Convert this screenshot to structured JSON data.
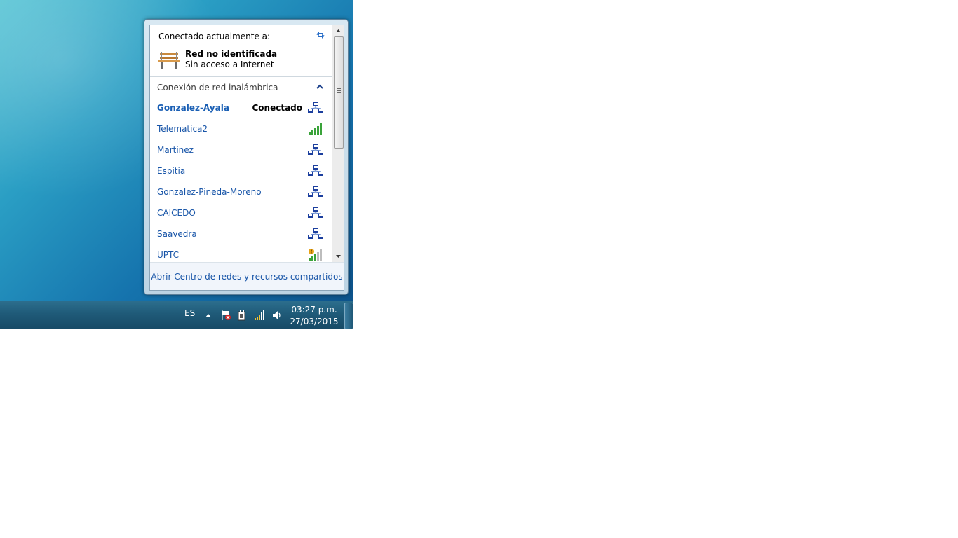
{
  "flyout": {
    "header_label": "Conectado actualmente a:",
    "current_network": {
      "name": "Red no identificada",
      "status": "Sin acceso a Internet",
      "icon": "bench-icon"
    },
    "section_label": "Conexión de red inalámbrica",
    "networks": [
      {
        "name": "Gonzalez-Ayala",
        "status": "Conectado",
        "icon": "network-icon",
        "active": true
      },
      {
        "name": "Telematica2",
        "status": "",
        "icon": "signal-full-icon",
        "active": false
      },
      {
        "name": "Martinez",
        "status": "",
        "icon": "network-icon",
        "active": false
      },
      {
        "name": "Espitia",
        "status": "",
        "icon": "network-icon",
        "active": false
      },
      {
        "name": "Gonzalez-Pineda-Moreno",
        "status": "",
        "icon": "network-icon",
        "active": false
      },
      {
        "name": "CAICEDO",
        "status": "",
        "icon": "network-icon",
        "active": false
      },
      {
        "name": "Saavedra",
        "status": "",
        "icon": "network-icon",
        "active": false
      },
      {
        "name": "UPTC",
        "status": "",
        "icon": "signal-warning-icon",
        "active": false
      }
    ],
    "footer_link": "Abrir Centro de redes y recursos compartidos"
  },
  "taskbar": {
    "language": "ES",
    "time": "03:27 p.m.",
    "date": "27/03/2015",
    "tray_icons": [
      "show-hidden-icons",
      "action-center-flag-icon",
      "power-icon",
      "network-signal-icon",
      "volume-icon"
    ]
  },
  "colors": {
    "link": "#1855a8",
    "signal_green": "#3aa33a",
    "taskbar": "#1f5a78"
  }
}
